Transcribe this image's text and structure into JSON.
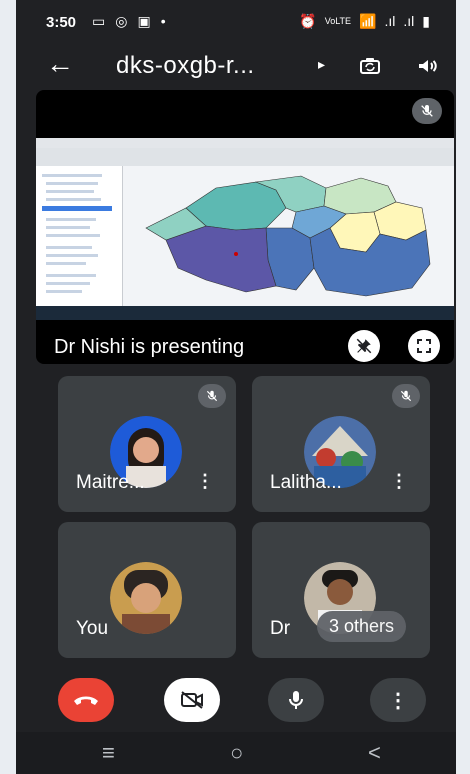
{
  "status_bar": {
    "time": "3:50",
    "left_icons": [
      "screen-cast",
      "whatsapp",
      "message",
      "dot"
    ],
    "right_icons": [
      "alarm",
      "volte",
      "wifi",
      "signal-1",
      "signal-2",
      "battery"
    ],
    "left_icon_glyphs": [
      "▭",
      "◎",
      "▣",
      "•"
    ],
    "right_icon_glyphs": [
      "⏰",
      "VoLTE",
      "📶",
      ".ıl",
      ".ıl",
      "▮"
    ]
  },
  "app_bar": {
    "back_symbol": "←",
    "title": "dks-oxgb-r...",
    "title_caret": "▸"
  },
  "presentation": {
    "caption": "Dr Nishi is presenting",
    "accent_colors": {
      "teal": "#5db9b2",
      "blue": "#4b74b8",
      "violet": "#5c57a7",
      "cream": "#fff7b9"
    }
  },
  "participants": [
    {
      "name": "Maitre...",
      "more": "⋮",
      "mic_muted": true
    },
    {
      "name": "Lalitha...",
      "more": "⋮",
      "mic_muted": true
    },
    {
      "name": "You"
    },
    {
      "name": "Dr",
      "others": "3 others"
    }
  ],
  "controls": {
    "end_call_color": "#ea4335",
    "video_off_color": "#ffffff",
    "mic_color": "#3c4043",
    "more_color": "#3c4043",
    "more_label": "⋮"
  },
  "nav": {
    "menu": "≡",
    "home": "○",
    "back": "<"
  }
}
